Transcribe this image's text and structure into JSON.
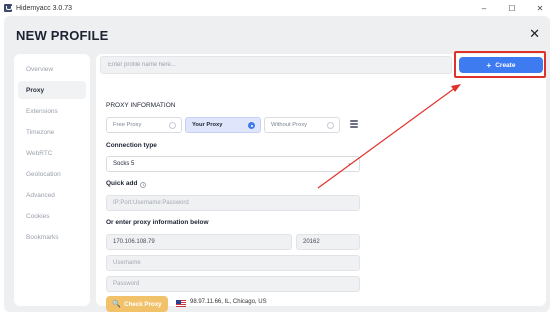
{
  "window": {
    "title": "Hidemyacc 3.0.73",
    "minimize": "–",
    "maximize": "☐",
    "close": "✕"
  },
  "page": {
    "title": "NEW PROFILE",
    "close_icon": "✕"
  },
  "sidebar": {
    "items": [
      {
        "label": "Overview",
        "active": false
      },
      {
        "label": "Proxy",
        "active": true
      },
      {
        "label": "Extensions",
        "active": false
      },
      {
        "label": "Timezone",
        "active": false
      },
      {
        "label": "WebRTC",
        "active": false
      },
      {
        "label": "Geolocation",
        "active": false
      },
      {
        "label": "Advanced",
        "active": false
      },
      {
        "label": "Cookies",
        "active": false
      },
      {
        "label": "Bookmarks",
        "active": false
      }
    ]
  },
  "profile_name": {
    "placeholder": "Enter profile name here...",
    "value": ""
  },
  "create_button": {
    "icon": "+",
    "label": "Create"
  },
  "proxy": {
    "section_title": "PROXY INFORMATION",
    "options": [
      {
        "label": "Free Proxy",
        "selected": false
      },
      {
        "label": "Your Proxy",
        "selected": true
      },
      {
        "label": "Without Proxy",
        "selected": false
      }
    ],
    "connection_type_label": "Connection type",
    "connection_type_value": "Socks 5",
    "quick_add_label": "Quick add",
    "quick_add_placeholder": "IP:Port:Username:Password",
    "enter_info_label": "Or enter proxy information below",
    "host_value": "170.106.108.79",
    "port_value": "20162",
    "username_placeholder": "Username",
    "password_placeholder": "Password",
    "check_button": {
      "icon": "🔍",
      "label": "Check Proxy"
    },
    "check_result": "98.97.11.66, IL, Chicago, US"
  },
  "colors": {
    "accent": "#3e7bf0",
    "highlight": "#e0322d",
    "check_button": "#f2c26b"
  }
}
